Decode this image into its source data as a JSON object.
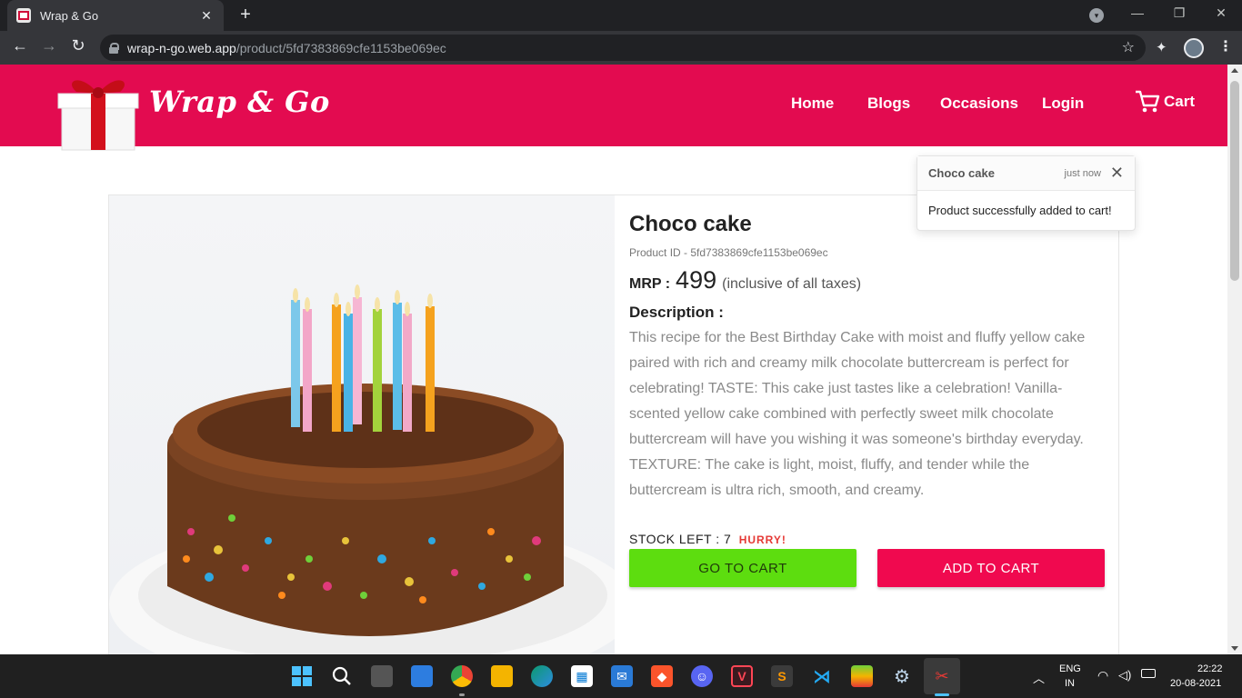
{
  "browser": {
    "tab_title": "Wrap & Go",
    "url_host": "wrap-n-go.web.app",
    "url_path": "/product/5fd7383869cfe1153be069ec"
  },
  "site": {
    "brand": "Wrap & Go",
    "nav": [
      "Home",
      "Blogs",
      "Occasions",
      "Login"
    ],
    "cart_label": "Cart",
    "brand_color": "#e30b50"
  },
  "product": {
    "title": "Choco cake",
    "id_line": "Product ID - 5fd7383869cfe1153be069ec",
    "mrp_label": "MRP :",
    "price": "499",
    "tax_note": "(inclusive of all taxes)",
    "description_heading": "Description :",
    "description": "This recipe for the Best Birthday Cake with moist and fluffy yellow cake paired with rich and creamy milk chocolate buttercream is perfect for celebrating! TASTE: This cake just tastes like a celebration! Vanilla-scented yellow cake combined with perfectly sweet milk chocolate buttercream will have you wishing it was someone's birthday everyday. TEXTURE: The cake is light, moist, fluffy, and tender while the buttercream is ultra rich, smooth, and creamy.",
    "stock_label": "STOCK LEFT : 7",
    "hurry": "HURRY!",
    "go_to_cart": "GO TO CART",
    "add_to_cart": "ADD TO CART"
  },
  "toast": {
    "title": "Choco cake",
    "time": "just now",
    "message": "Product successfully added to cart!"
  },
  "taskbar": {
    "lang_top": "ENG",
    "lang_bottom": "IN",
    "time": "22:22",
    "date": "20-08-2021"
  }
}
